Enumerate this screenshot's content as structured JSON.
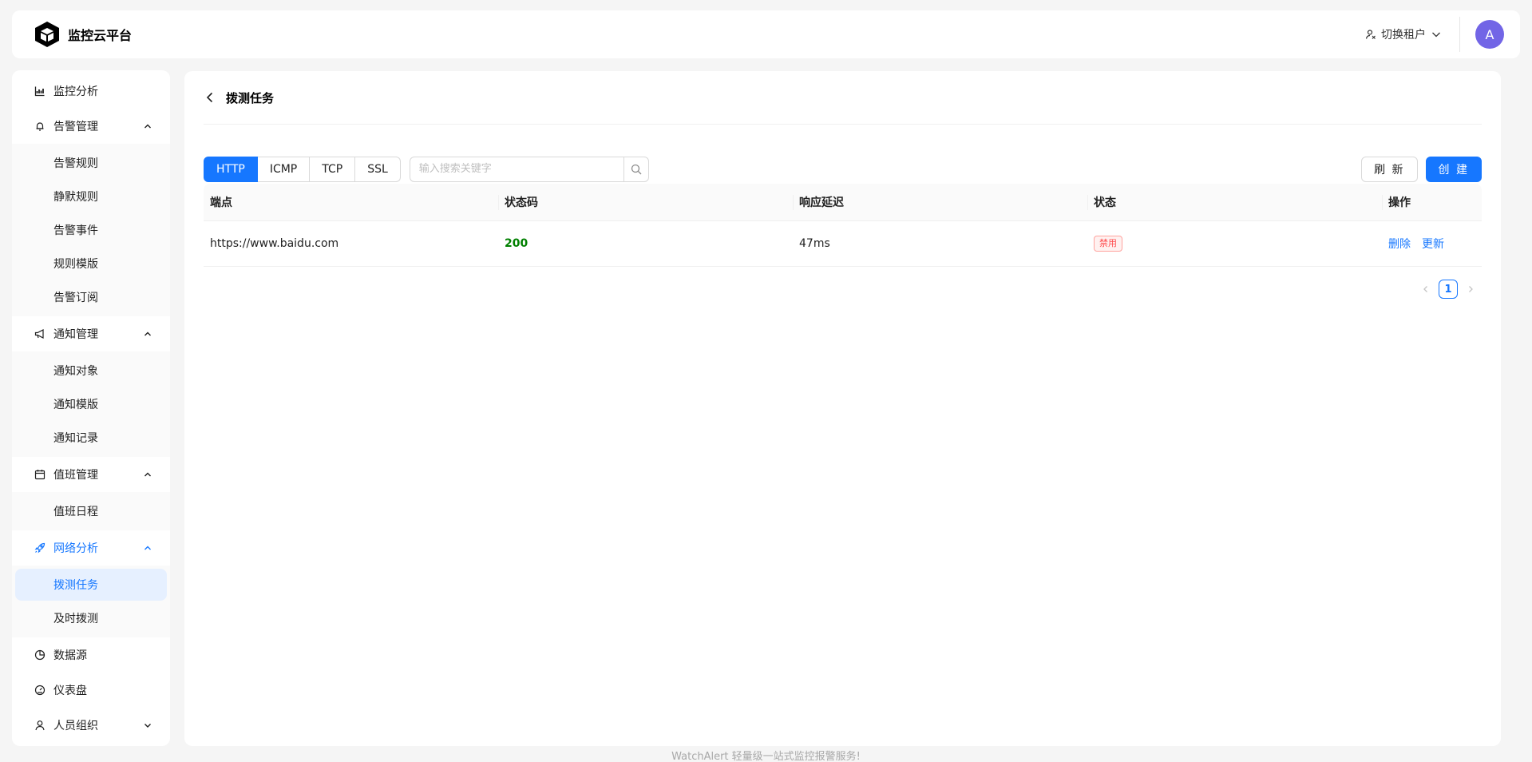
{
  "brand": {
    "title": "监控云平台",
    "logo": "cube-logo"
  },
  "header": {
    "tenant_switch_label": "切换租户",
    "avatar_initial": "A"
  },
  "sidebar": {
    "items": [
      {
        "label": "监控分析",
        "icon": "chart-icon"
      },
      {
        "label": "告警管理",
        "icon": "bell-icon",
        "children": [
          "告警规则",
          "静默规则",
          "告警事件",
          "规则模版",
          "告警订阅"
        ]
      },
      {
        "label": "通知管理",
        "icon": "megaphone-icon",
        "children": [
          "通知对象",
          "通知模版",
          "通知记录"
        ]
      },
      {
        "label": "值班管理",
        "icon": "calendar-icon",
        "children": [
          "值班日程"
        ]
      },
      {
        "label": "网络分析",
        "icon": "rocket-icon",
        "children": [
          "拨测任务",
          "及时拨测"
        ]
      },
      {
        "label": "数据源",
        "icon": "pie-icon"
      },
      {
        "label": "仪表盘",
        "icon": "gauge-icon"
      },
      {
        "label": "人员组织",
        "icon": "user-icon"
      }
    ],
    "active_item": "拨测任务"
  },
  "page": {
    "title": "拨测任务"
  },
  "toolbar": {
    "tabs": [
      "HTTP",
      "ICMP",
      "TCP",
      "SSL"
    ],
    "active_tab": "HTTP",
    "search_placeholder": "输入搜索关键字",
    "refresh_label": "刷 新",
    "create_label": "创 建"
  },
  "table": {
    "columns": [
      "端点",
      "状态码",
      "响应延迟",
      "状态",
      "操作"
    ],
    "rows": [
      {
        "endpoint": "https://www.baidu.com",
        "status_code": "200",
        "latency": "47ms",
        "status": "禁用",
        "actions": [
          "删除",
          "更新"
        ]
      }
    ]
  },
  "pagination": {
    "current": "1"
  },
  "footer": {
    "text": "WatchAlert 轻量级一站式监控报警服务!"
  },
  "colors": {
    "primary": "#1677ff",
    "success": "#008000",
    "danger": "#ff4d4f",
    "avatar": "#7265e6"
  }
}
